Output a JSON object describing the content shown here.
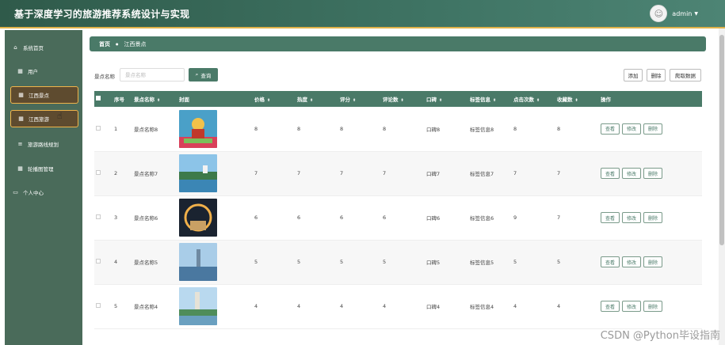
{
  "header": {
    "title": "基于深度学习的旅游推荐系统设计与实现",
    "username": "admin"
  },
  "sidebar": {
    "items": [
      {
        "label": "系统首页",
        "icon": "home-icon"
      },
      {
        "label": "用户",
        "icon": "grid-icon"
      },
      {
        "label": "江西景点",
        "icon": "grid-icon"
      },
      {
        "label": "江西旅游",
        "icon": "grid-icon"
      },
      {
        "label": "旅游路线规划",
        "icon": "list-icon"
      },
      {
        "label": "轮播图管理",
        "icon": "grid-icon"
      },
      {
        "label": "个人中心",
        "icon": "card-icon"
      }
    ]
  },
  "breadcrumb": {
    "home": "首页",
    "current": "江西景点"
  },
  "search": {
    "label": "景点名称",
    "placeholder": "景点名称",
    "button": "查询"
  },
  "toolbar": {
    "add": "添加",
    "delete": "删除",
    "crawl": "爬取数据"
  },
  "table": {
    "headers": [
      "序号",
      "景点名称",
      "封面",
      "价格",
      "热度",
      "评分",
      "评论数",
      "口碑",
      "标签信息",
      "点击次数",
      "收藏数",
      "操作"
    ],
    "rows": [
      {
        "index": "1",
        "name": "景点名称8",
        "price": "8",
        "heat": "8",
        "score": "8",
        "comments": "8",
        "reputation": "口碑8",
        "tags": "标签信息8",
        "clicks": "8",
        "favorites": "8"
      },
      {
        "index": "2",
        "name": "景点名称7",
        "price": "7",
        "heat": "7",
        "score": "7",
        "comments": "7",
        "reputation": "口碑7",
        "tags": "标签信息7",
        "clicks": "7",
        "favorites": "7"
      },
      {
        "index": "3",
        "name": "景点名称6",
        "price": "6",
        "heat": "6",
        "score": "6",
        "comments": "6",
        "reputation": "口碑6",
        "tags": "标签信息6",
        "clicks": "9",
        "favorites": "7"
      },
      {
        "index": "4",
        "name": "景点名称5",
        "price": "5",
        "heat": "5",
        "score": "5",
        "comments": "5",
        "reputation": "口碑5",
        "tags": "标签信息5",
        "clicks": "5",
        "favorites": "5"
      },
      {
        "index": "5",
        "name": "景点名称4",
        "price": "4",
        "heat": "4",
        "score": "4",
        "comments": "4",
        "reputation": "口碑4",
        "tags": "标签信息4",
        "clicks": "4",
        "favorites": "4"
      }
    ],
    "actions": {
      "view": "查看",
      "edit": "修改",
      "delete": "删除"
    }
  },
  "watermark": "CSDN @Python毕设指南"
}
